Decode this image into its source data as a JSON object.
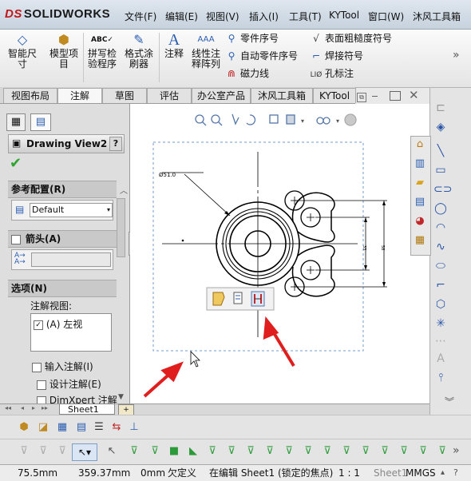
{
  "app": {
    "brand_prefix": "DS",
    "brand_name": "SOLIDWORKS"
  },
  "menubar": [
    "文件(F)",
    "编辑(E)",
    "视图(V)",
    "插入(I)",
    "工具(T)",
    "KYTool",
    "窗口(W)",
    "沐风工具箱"
  ],
  "ribbon": {
    "large_buttons": [
      {
        "label_1": "智能尺",
        "label_2": "寸",
        "icon": "smart-dimension-icon"
      },
      {
        "label_1": "模型项",
        "label_2": "目",
        "icon": "model-items-icon"
      },
      {
        "label_1": "拼写检",
        "label_2": "验程序",
        "icon": "spell-check-icon"
      },
      {
        "label_1": "格式涂",
        "label_2": "刷器",
        "icon": "format-painter-icon"
      },
      {
        "label_1": "注释",
        "label_2": "",
        "icon": "note-icon"
      },
      {
        "label_1": "线性注",
        "label_2": "释阵列",
        "icon": "linear-note-pattern-icon"
      }
    ],
    "small_col1": [
      "零件序号",
      "自动零件序号",
      "磁力线"
    ],
    "small_col2": [
      "表面粗糙度符号",
      "焊接符号",
      "孔标注"
    ]
  },
  "tabs": [
    "视图布局",
    "注解",
    "草图",
    "评估",
    "办公室产品",
    "沐风工具箱",
    "KYTool"
  ],
  "active_tab": "注解",
  "property_manager": {
    "title": "Drawing View2",
    "help": "?",
    "ref_config_header": "参考配置(R)",
    "ref_config_value": "Default",
    "arrow_header": "箭头(A)",
    "arrow_label": "A",
    "options_header": "选项(N)",
    "annotation_view_label": "注解视图:",
    "annotation_view_item": "(A) 左视",
    "import_annotations": "输入注解(I)",
    "design_annotations": "设计注解(E)",
    "dimxpert_annotations": "DimXpert 注解"
  },
  "drawing": {
    "diameter_label": "Ø51.0",
    "dim_left": "33",
    "dim_right": "58"
  },
  "sheet_tab": "Sheet1",
  "status": {
    "x": "75.5mm",
    "y": "359.37mm",
    "z": "0mm",
    "state": "欠定义",
    "editing": "在编辑 Sheet1 (锁定的焦点)",
    "scale": "1 : 1",
    "units": "MMGS"
  }
}
